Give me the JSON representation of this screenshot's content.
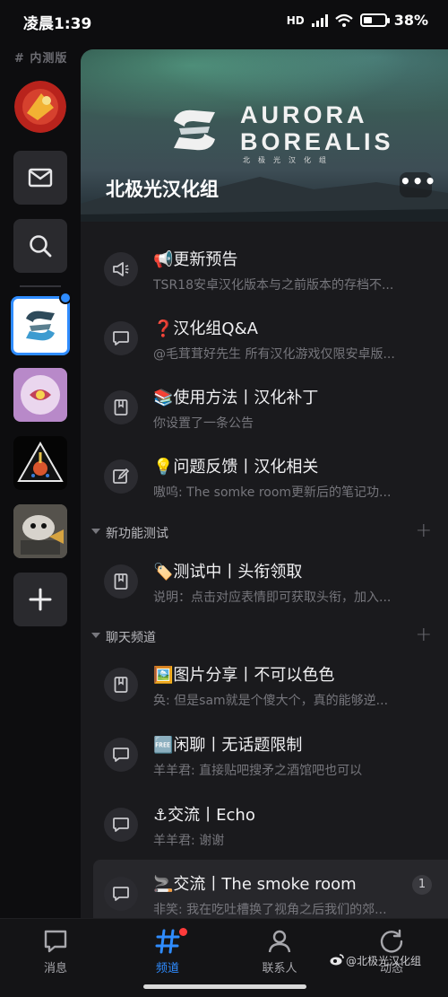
{
  "status_bar": {
    "time": "凌晨1:39",
    "network": "HD",
    "battery": "38%"
  },
  "rail": {
    "label": "# 内测版"
  },
  "guild": {
    "name": "北极光汉化组",
    "logo_line1": "AURORA",
    "logo_line2": "BOREALIS",
    "logo_sub": "北极光汉化组"
  },
  "channels_top": [
    {
      "emoji": "📢",
      "title": "更新预告",
      "subtitle": "TSR18安卓汉化版本与之前版本的存档不...",
      "icon": "announcement-icon"
    },
    {
      "emoji": "❓",
      "title": "汉化组Q&A",
      "subtitle": "@毛茸茸好先生 所有汉化游戏仅限安卓版...",
      "icon": "chat-icon"
    },
    {
      "emoji": "📚",
      "title": "使用方法丨汉化补丁",
      "subtitle": "你设置了一条公告",
      "icon": "bookmark-icon"
    },
    {
      "emoji": "💡",
      "title": "问题反馈丨汉化相关",
      "subtitle": "嗷呜: The somke room更新后的笔记功...",
      "icon": "edit-icon"
    }
  ],
  "section_test": {
    "title": "新功能测试"
  },
  "channels_test": [
    {
      "emoji": "🏷️",
      "title": "测试中丨头衔领取",
      "subtitle": "说明：点击对应表情即可获取头衔，加入...",
      "icon": "bookmark-icon"
    }
  ],
  "section_chat": {
    "title": "聊天频道"
  },
  "channels_chat": [
    {
      "emoji": "🖼️",
      "title": "图片分享丨不可以色色",
      "subtitle": "奂: 但是sam就是个傻大个，真的能够逆...",
      "icon": "bookmark-icon"
    },
    {
      "emoji": "🆓",
      "title": "闲聊丨无话题限制",
      "subtitle": "羊羊君: 直接贴吧搜矛之酒馆吧也可以",
      "icon": "chat-icon"
    },
    {
      "emoji": "⚓",
      "title": "交流丨Echo",
      "subtitle": "羊羊君: 谢谢",
      "icon": "chat-icon"
    },
    {
      "emoji": "🚬",
      "title": "交流丨The smoke room",
      "subtitle": "非笑: 我在吃吐槽换了视角之后我们的郊...",
      "icon": "chat-icon",
      "badge": "1"
    }
  ],
  "bottom_nav": [
    {
      "label": "消息"
    },
    {
      "label": "频道"
    },
    {
      "label": "联系人"
    },
    {
      "label": "动态"
    }
  ],
  "watermark": "@北极光汉化组",
  "colors": {
    "accent": "#2f8cff",
    "panel": "#1a1a1d",
    "background": "#0d0d0f",
    "notify_red": "#ff3b3b"
  }
}
